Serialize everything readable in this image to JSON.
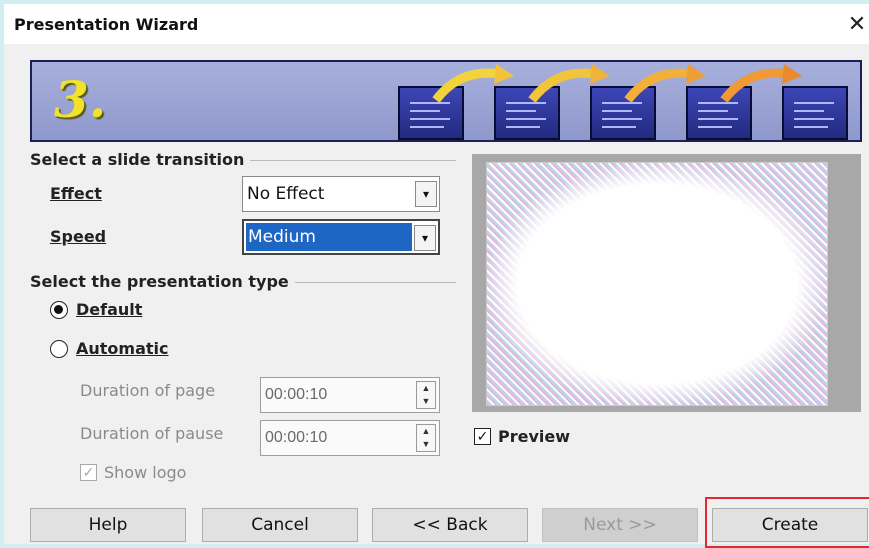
{
  "window": {
    "title": "Presentation Wizard",
    "close_glyph": "✕"
  },
  "banner": {
    "step_number": "3."
  },
  "transition": {
    "group_label": "Select a slide transition",
    "effect_label": "Effect",
    "effect_value": "No Effect",
    "speed_label": "Speed",
    "speed_value": "Medium"
  },
  "presentation_type": {
    "group_label": "Select the presentation type",
    "default_label": "Default",
    "default_selected": true,
    "automatic_label": "Automatic",
    "automatic_selected": false,
    "duration_page_label": "Duration of page",
    "duration_page_value": "00:00:10",
    "duration_pause_label": "Duration of pause",
    "duration_pause_value": "00:00:10",
    "show_logo_label": "Show logo",
    "show_logo_checked": true
  },
  "preview": {
    "label": "Preview",
    "checked": true
  },
  "buttons": {
    "help": "Help",
    "cancel": "Cancel",
    "back": "<< Back",
    "next": "Next >>",
    "create": "Create"
  },
  "colors": {
    "highlight": "#e0282e",
    "selection": "#1e66c4",
    "banner": "#9aa3d6"
  }
}
